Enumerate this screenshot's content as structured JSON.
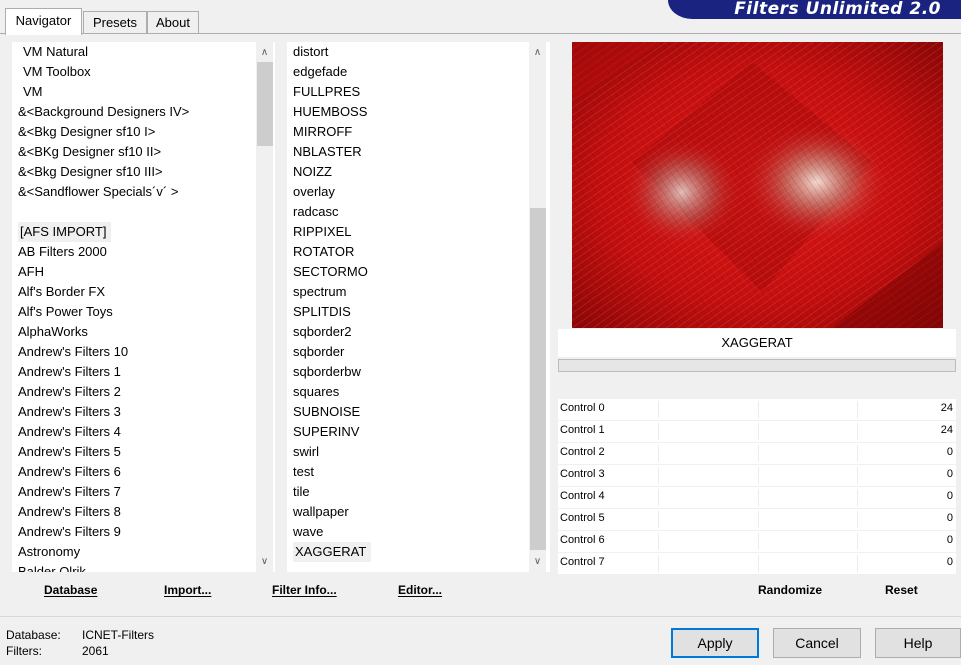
{
  "app_title": "Filters Unlimited 2.0",
  "tabs": [
    {
      "label": "Navigator",
      "active": true
    },
    {
      "label": "Presets",
      "active": false
    },
    {
      "label": "About",
      "active": false
    }
  ],
  "categories": [
    "VM Natural",
    "VM Toolbox",
    "VM",
    "&<Background Designers IV>",
    "&<Bkg Designer sf10 I>",
    "&<BKg Designer sf10 II>",
    "&<Bkg Designer sf10 III>",
    "&<Sandflower Specials´v´ >",
    "",
    "[AFS IMPORT]",
    "AB Filters 2000",
    "AFH",
    "Alf's Border FX",
    "Alf's Power Toys",
    "AlphaWorks",
    "Andrew's Filters 10",
    "Andrew's Filters 1",
    "Andrew's Filters 2",
    "Andrew's Filters 3",
    "Andrew's Filters 4",
    "Andrew's Filters 5",
    "Andrew's Filters 6",
    "Andrew's Filters 7",
    "Andrew's Filters 8",
    "Andrew's Filters 9",
    "Astronomy",
    "Balder Olrik"
  ],
  "selected_category": "[AFS IMPORT]",
  "filters": [
    "distort",
    "edgefade",
    "FULLPRES",
    "HUEMBOSS",
    "MIRROFF",
    "NBLASTER",
    "NOIZZ",
    "overlay",
    "radcasc",
    "RIPPIXEL",
    "ROTATOR",
    "SECTORMO",
    "spectrum",
    "SPLITDIS",
    "sqborder2",
    "sqborder",
    "sqborderbw",
    "squares",
    "SUBNOISE",
    "SUPERINV",
    "swirl",
    "test",
    "tile",
    "wallpaper",
    "wave",
    "XAGGERAT"
  ],
  "selected_filter": "XAGGERAT",
  "preview_filter_name": "XAGGERAT",
  "controls": [
    {
      "label": "Control 0",
      "value": "24"
    },
    {
      "label": "Control 1",
      "value": "24"
    },
    {
      "label": "Control 2",
      "value": "0"
    },
    {
      "label": "Control 3",
      "value": "0"
    },
    {
      "label": "Control 4",
      "value": "0"
    },
    {
      "label": "Control 5",
      "value": "0"
    },
    {
      "label": "Control 6",
      "value": "0"
    },
    {
      "label": "Control 7",
      "value": "0"
    }
  ],
  "bottom_links": {
    "database": "Database",
    "import": "Import...",
    "filter_info": "Filter Info...",
    "editor": "Editor...",
    "randomize": "Randomize",
    "reset": "Reset"
  },
  "status": {
    "database_label": "Database:",
    "database_value": "ICNET-Filters",
    "filters_label": "Filters:",
    "filters_value": "2061"
  },
  "buttons": {
    "apply": "Apply",
    "cancel": "Cancel",
    "help": "Help"
  },
  "colors": {
    "banner": "#1a2480",
    "preview_red": "#c81010",
    "default_button_border": "#0078d7"
  },
  "icons": {
    "scroll_up": "∧",
    "scroll_down": "∨"
  }
}
